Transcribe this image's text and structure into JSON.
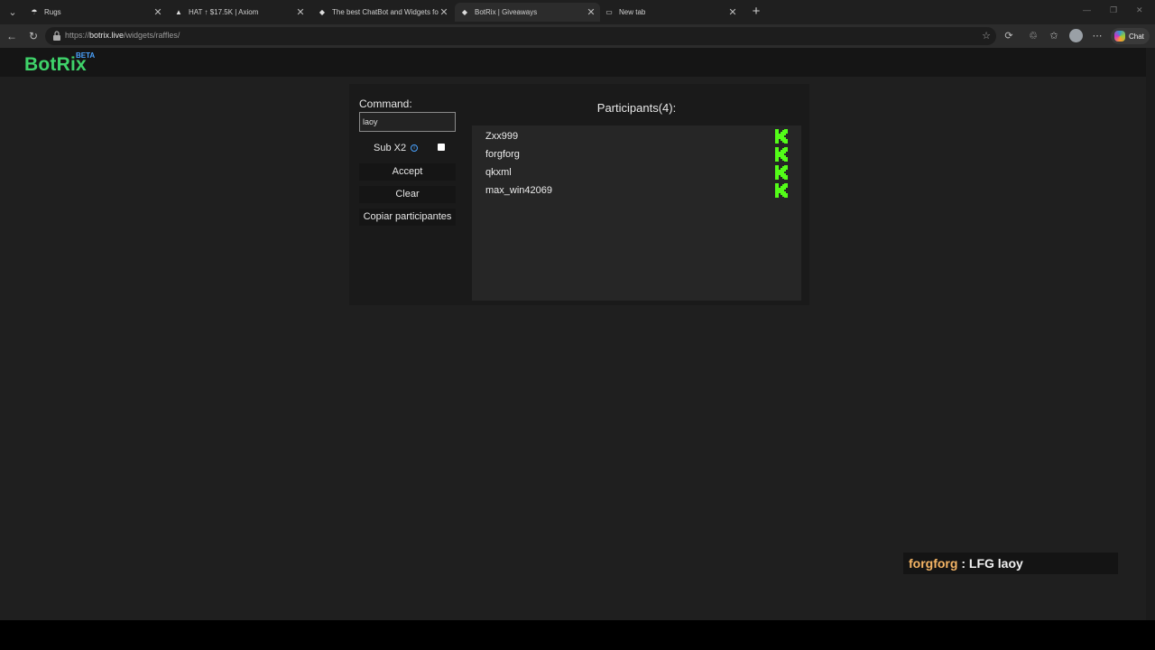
{
  "browser": {
    "tabs": [
      {
        "title": "Rugs",
        "icon": "rugs-favicon",
        "active": false
      },
      {
        "title": "HAT ↑ $17.5K | Axiom",
        "icon": "axiom-favicon",
        "active": false
      },
      {
        "title": "The best ChatBot and Widgets for",
        "icon": "botrix-favicon",
        "active": false
      },
      {
        "title": "BotRix | Giveaways",
        "icon": "botrix-favicon",
        "active": true
      },
      {
        "title": "New tab",
        "icon": "newtab-favicon",
        "active": false
      }
    ],
    "url_prefix": "https://",
    "url_domain": "botrix.live",
    "url_path": "/widgets/raffles/",
    "chat_label": "Chat"
  },
  "site": {
    "logo": "BotRix",
    "beta": "BETA",
    "brand_color": "#3fd36a"
  },
  "raffle": {
    "command_label": "Command:",
    "command_value": "laoy",
    "sub_label": "Sub X2",
    "sub_checked": false,
    "accept_label": "Accept",
    "clear_label": "Clear",
    "copy_label": "Copiar participantes",
    "participants_title": "Participants(4):",
    "participants": [
      {
        "name": "Zxx999",
        "platform": "kick-icon"
      },
      {
        "name": "forgforg",
        "platform": "kick-icon"
      },
      {
        "name": "qkxml",
        "platform": "kick-icon"
      },
      {
        "name": "max_win42069",
        "platform": "kick-icon"
      }
    ]
  },
  "chat_message": {
    "user": "forgforg",
    "separator": " : ",
    "text": "LFG laoy"
  }
}
